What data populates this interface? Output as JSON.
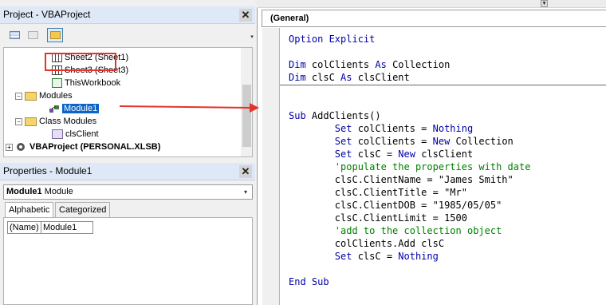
{
  "project": {
    "title": "Project - VBAProject",
    "tree": {
      "sheet2": "Sheet2 (Sheet1)",
      "sheet3": "Sheet3 (Sheet3)",
      "workbook": "ThisWorkbook",
      "modules": "Modules",
      "module1": "Module1",
      "class_modules": "Class Modules",
      "cls_client": "clsClient",
      "personal": "VBAProject (PERSONAL.XLSB)"
    }
  },
  "properties": {
    "title": "Properties - Module1",
    "object_name": "Module1",
    "object_type": "Module",
    "tabs": [
      "Alphabetic",
      "Categorized"
    ],
    "row_name": "(Name)",
    "row_value": "Module1"
  },
  "code": {
    "header": "(General)",
    "lines": {
      "l1a": "Option Explicit",
      "l2a": "Dim ",
      "l2b": "colClients ",
      "l2c": "As ",
      "l2d": "Collection",
      "l3a": "Dim ",
      "l3b": "clsC ",
      "l3c": "As ",
      "l3d": "clsClient",
      "l4a": "Sub ",
      "l4b": "AddClients()",
      "l5a": "        Set ",
      "l5b": "colClients = ",
      "l5c": "Nothing",
      "l6a": "        Set ",
      "l6b": "colClients = ",
      "l6c": "New ",
      "l6d": "Collection",
      "l7a": "        Set ",
      "l7b": "clsC = ",
      "l7c": "New ",
      "l7d": "clsClient",
      "l8": "        'populate the properties with date",
      "l9": "        clsC.ClientName = \"James Smith\"",
      "l10": "        clsC.ClientTitle = \"Mr\"",
      "l11": "        clsC.ClientDOB = \"1985/05/05\"",
      "l12": "        clsC.ClientLimit = 1500",
      "l13": "        'add to the collection object",
      "l14": "        colClients.Add clsC",
      "l15a": "        Set ",
      "l15b": "clsC = ",
      "l15c": "Nothing",
      "l16": "End Sub"
    }
  },
  "glyphs": {
    "close": "✕",
    "expand": "+",
    "collapse": "−",
    "dropdown": "▾"
  },
  "colors": {
    "keyword": "#0000a8",
    "comment": "#008000",
    "highlight": "#e5332a",
    "selection": "#0a64c9"
  }
}
